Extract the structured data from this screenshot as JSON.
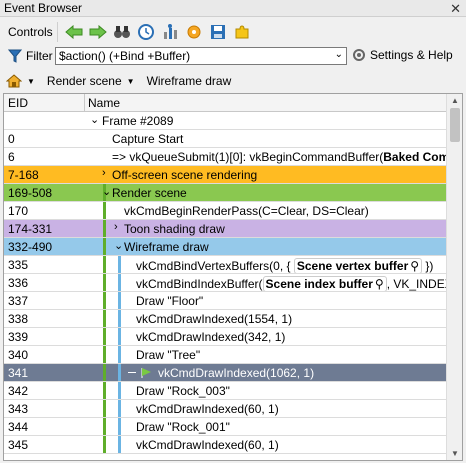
{
  "window": {
    "title": "Event Browser",
    "close": "✕"
  },
  "toolbar": {
    "controls_label": "Controls"
  },
  "filter": {
    "label": "Filter",
    "value": "$action() (+Bind +Buffer)",
    "settings_label": "Settings & Help"
  },
  "markers": {
    "render_scene": "Render scene",
    "wireframe": "Wireframe draw"
  },
  "tree": {
    "columns": {
      "eid": "EID",
      "name": "Name"
    },
    "rows": [
      {
        "eid": "",
        "name": "Frame #2089"
      },
      {
        "eid": "0",
        "name": "Capture Start"
      },
      {
        "eid": "6",
        "name": "=> vkQueueSubmit(1)[0]: vkBeginCommandBuffer(",
        "bold": "Baked Comman"
      },
      {
        "eid": "7-168",
        "name": "Off-screen scene rendering"
      },
      {
        "eid": "169-508",
        "name": "Render scene"
      },
      {
        "eid": "170",
        "name": "vkCmdBeginRenderPass(C=Clear, DS=Clear)"
      },
      {
        "eid": "174-331",
        "name": "Toon shading draw"
      },
      {
        "eid": "332-490",
        "name": "Wireframe draw"
      },
      {
        "eid": "335",
        "name": "vkCmdBindVertexBuffers(0, {",
        "pill": "Scene vertex buffer",
        "tail": "})"
      },
      {
        "eid": "336",
        "name": "vkCmdBindIndexBuffer(",
        "pill": "Scene index buffer",
        "tail": ", VK_INDEX_TY"
      },
      {
        "eid": "337",
        "name": "Draw \"Floor\""
      },
      {
        "eid": "338",
        "name": "vkCmdDrawIndexed(1554, 1)"
      },
      {
        "eid": "339",
        "name": "vkCmdDrawIndexed(342, 1)"
      },
      {
        "eid": "340",
        "name": "Draw \"Tree\""
      },
      {
        "eid": "341",
        "name": "vkCmdDrawIndexed(1062, 1)"
      },
      {
        "eid": "342",
        "name": "Draw \"Rock_003\""
      },
      {
        "eid": "343",
        "name": "vkCmdDrawIndexed(60, 1)"
      },
      {
        "eid": "344",
        "name": "Draw \"Rock_001\""
      },
      {
        "eid": "345",
        "name": "vkCmdDrawIndexed(60, 1)"
      }
    ]
  },
  "colors": {
    "orange": "#ffbb22",
    "green": "#8ac850",
    "purple": "#c9b2e4",
    "blue": "#95c9ea",
    "selected": "#6e7b93"
  }
}
